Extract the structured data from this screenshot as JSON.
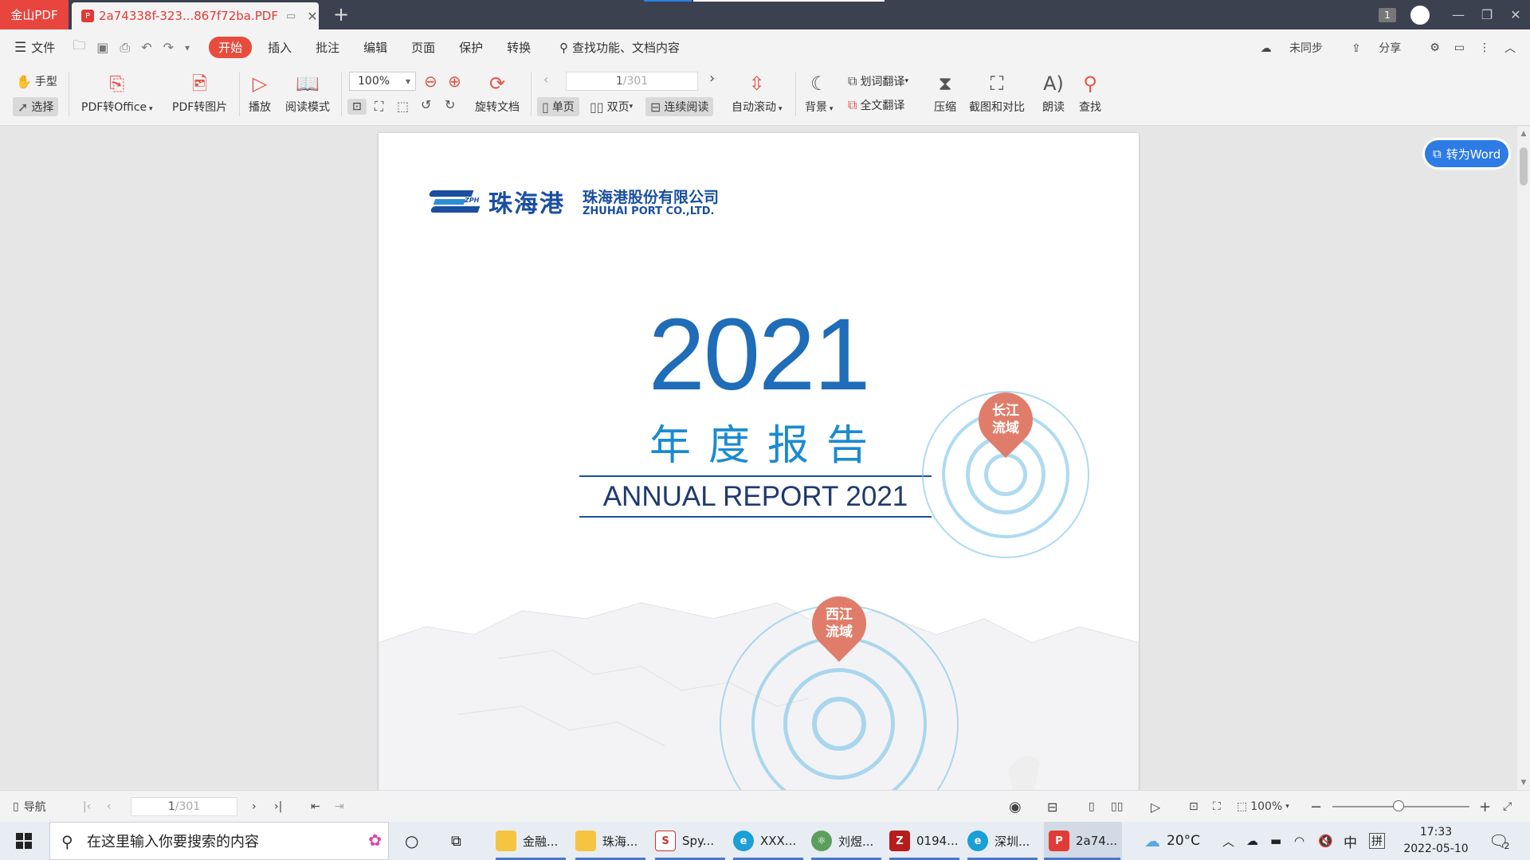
{
  "titlebar": {
    "app_name": "金山PDF",
    "doc_tab": "2a74338f-323...867f72ba.PDF",
    "page_badge": "1"
  },
  "menu": {
    "file": "文件",
    "tabs": [
      "开始",
      "插入",
      "批注",
      "编辑",
      "页面",
      "保护",
      "转换"
    ],
    "search": "查找功能、文档内容",
    "unsynced": "未同步",
    "share": "分享"
  },
  "ribbon": {
    "hand": "手型",
    "select": "选择",
    "pdf_to_office": "PDF转Office",
    "pdf_to_image": "PDF转图片",
    "play": "播放",
    "read_mode": "阅读模式",
    "zoom": "100%",
    "rotate": "旋转文档",
    "page_current": "1",
    "page_total": "/301",
    "single": "单页",
    "double": "双页",
    "continuous": "连续阅读",
    "autoscroll": "自动滚动",
    "background": "背景",
    "word_translate": "划词翻译",
    "full_translate": "全文翻译",
    "compress": "压缩",
    "screenshot_compare": "截图和对比",
    "read_aloud": "朗读",
    "find": "查找"
  },
  "document": {
    "company_short": "珠海港",
    "company_cn": "珠海港股份有限公司",
    "company_en": "ZHUHAI PORT CO.,LTD.",
    "logo_tag": "ZPH",
    "year": "2021",
    "title_cn": "年度报告",
    "title_en": "ANNUAL REPORT 2021",
    "pin1": [
      "长江",
      "流域"
    ],
    "pin2": [
      "西江",
      "流域"
    ]
  },
  "to_word": "转为Word",
  "statusbar": {
    "nav": "导航",
    "page_current": "1",
    "page_total": "/301",
    "zoom": "100%"
  },
  "taskbar": {
    "search_placeholder": "在这里输入你要搜索的内容",
    "items": [
      "金融...",
      "珠海...",
      "Spy...",
      "XXX...",
      "刘煜...",
      "0194...",
      "深圳...",
      "2a74..."
    ],
    "weather": "20°C",
    "ime1": "中",
    "ime2": "拼",
    "time": "17:33",
    "date": "2022-05-10",
    "notif_count": "2"
  },
  "colors": {
    "accent_red": "#e84c3d",
    "brand_blue": "#1a4fa0",
    "word_blue": "#2d7be5"
  }
}
